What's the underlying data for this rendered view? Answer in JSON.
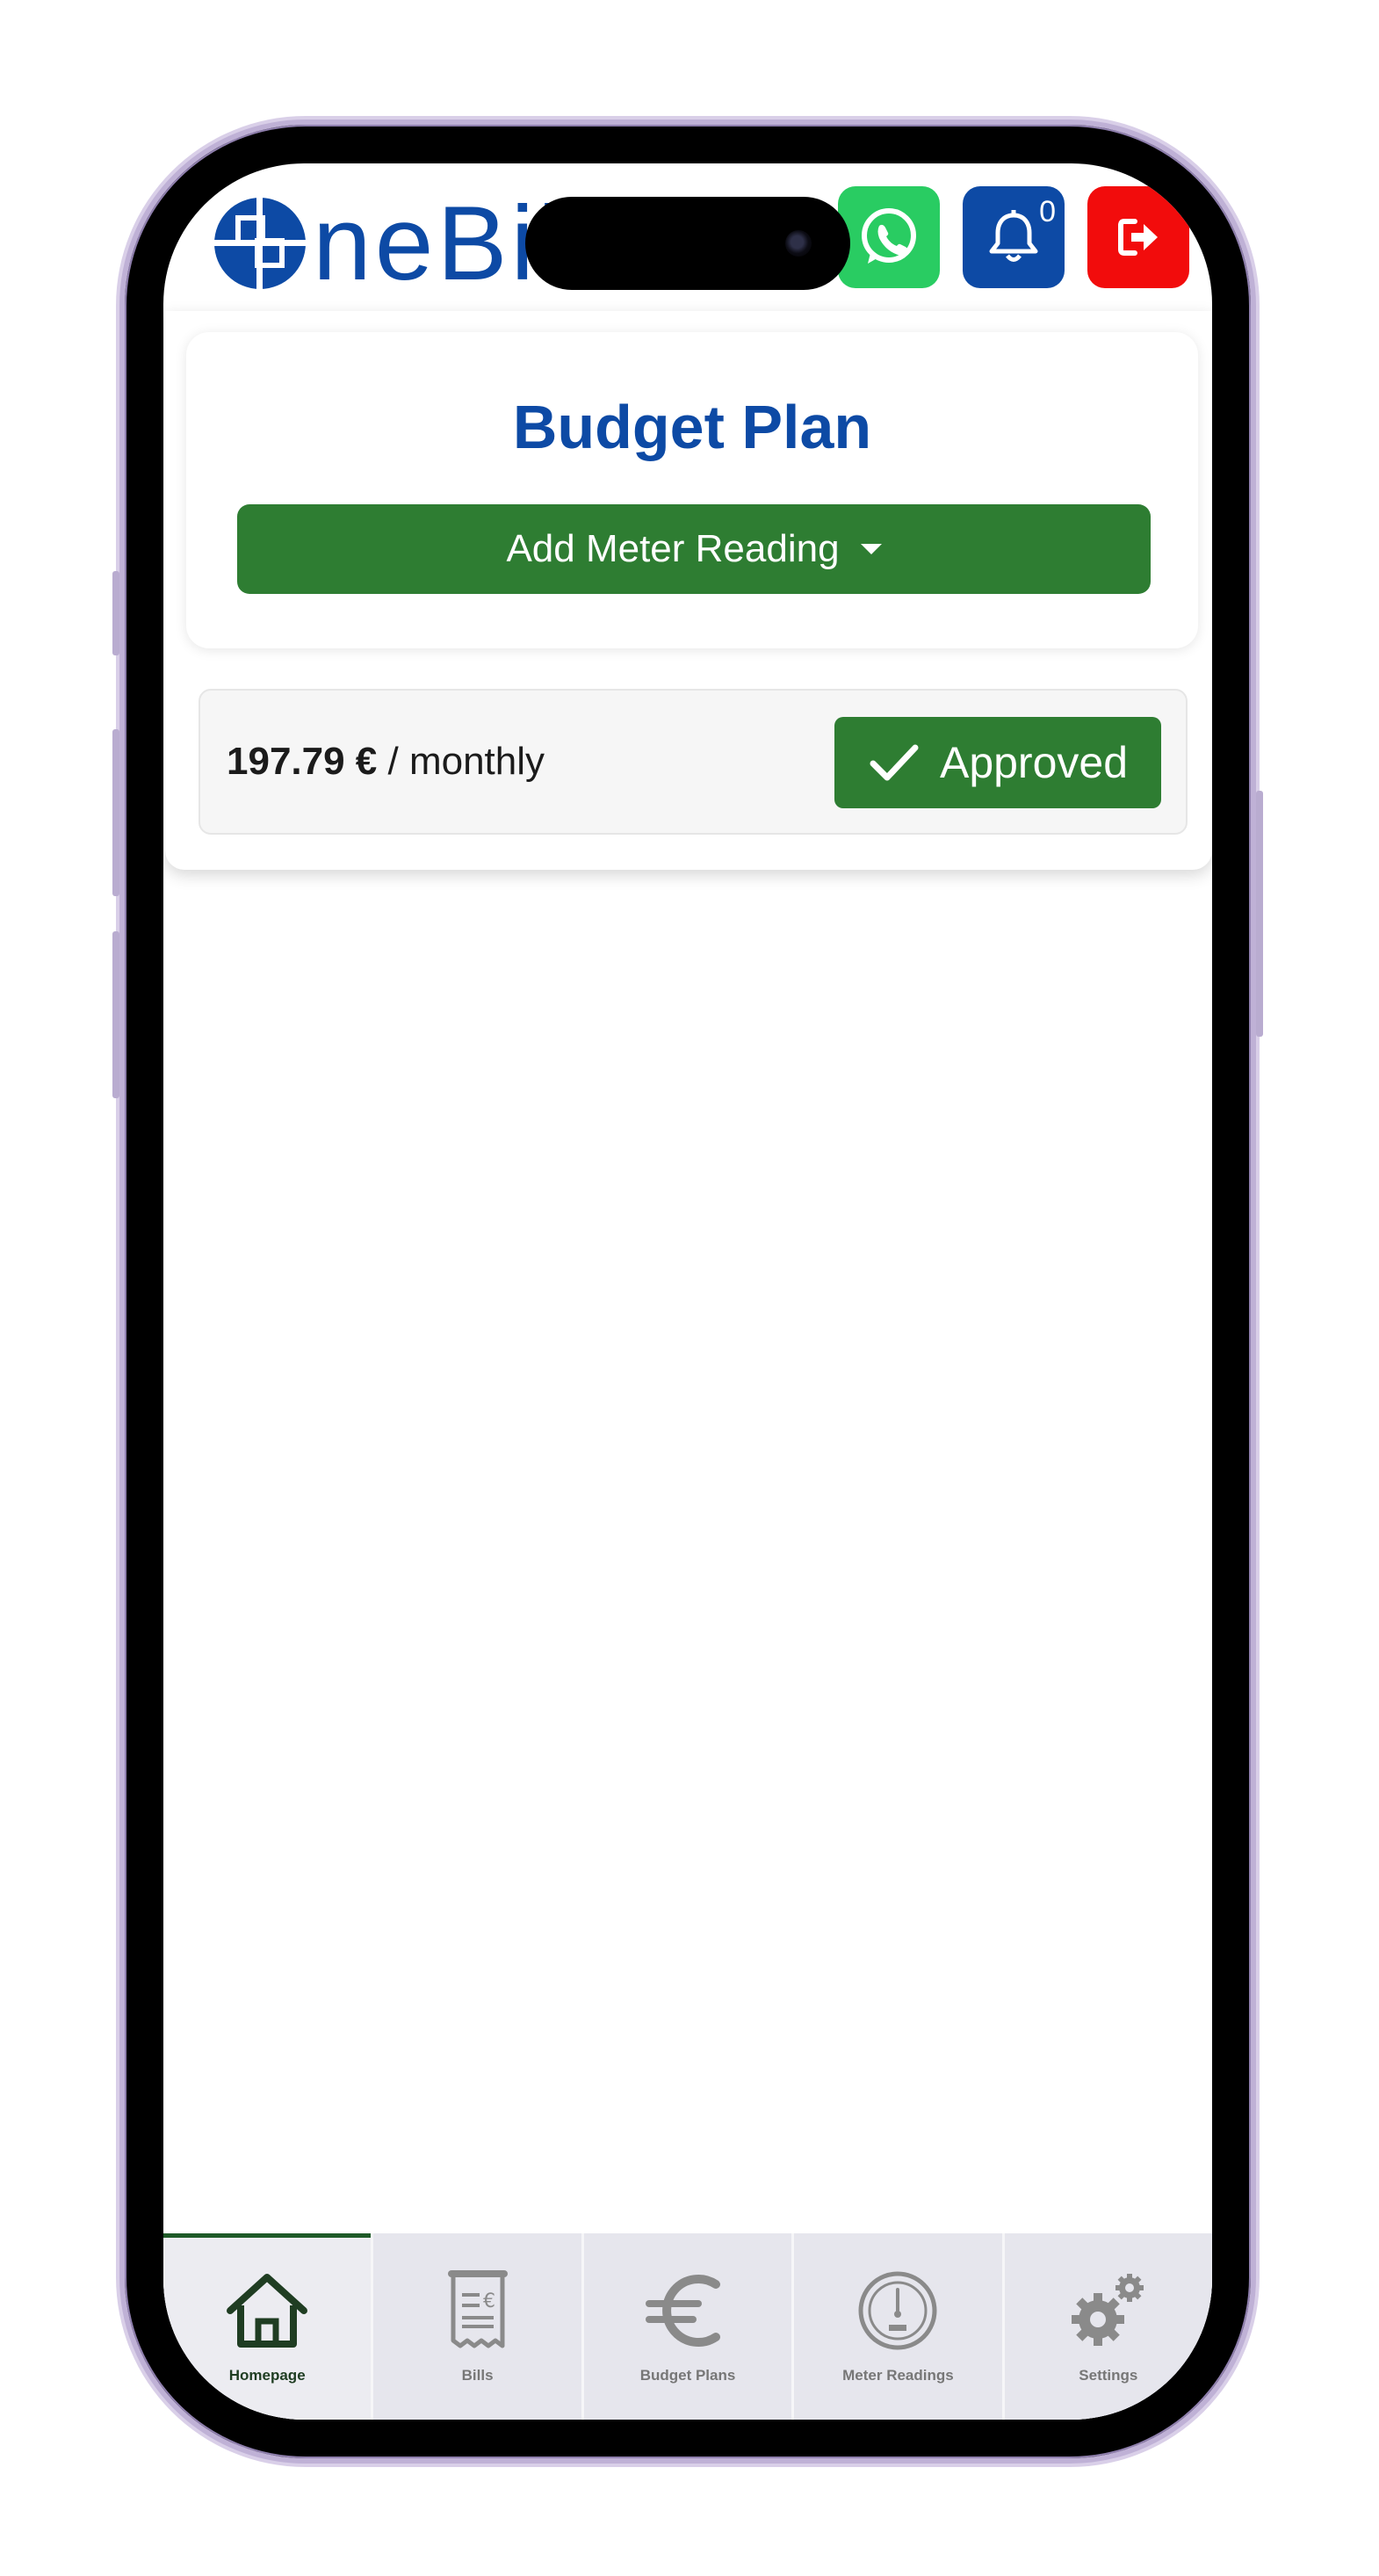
{
  "header": {
    "logo_text": "neBill",
    "whatsapp_icon": "whatsapp-icon",
    "notifications_icon": "bell-icon",
    "notification_count": "0",
    "logout_icon": "logout-icon"
  },
  "budget_card": {
    "title": "Budget Plan",
    "add_meter_reading_label": "Add Meter Reading"
  },
  "plan": {
    "amount": "197.79 €",
    "period": "/ monthly",
    "status": "Approved",
    "status_color": "#2e7d32"
  },
  "nav": {
    "items": [
      {
        "label": "Homepage",
        "icon": "home-icon",
        "active": true
      },
      {
        "label": "Bills",
        "icon": "bill-icon",
        "active": false
      },
      {
        "label": "Budget Plans",
        "icon": "euro-icon",
        "active": false
      },
      {
        "label": "Meter Readings",
        "icon": "meter-icon",
        "active": false
      },
      {
        "label": "Settings",
        "icon": "gears-icon",
        "active": false
      }
    ]
  },
  "colors": {
    "brand_blue": "#0d4aa5",
    "action_green": "#2e7d32",
    "whatsapp_green": "#29cc62",
    "logout_red": "#f20c0c"
  }
}
